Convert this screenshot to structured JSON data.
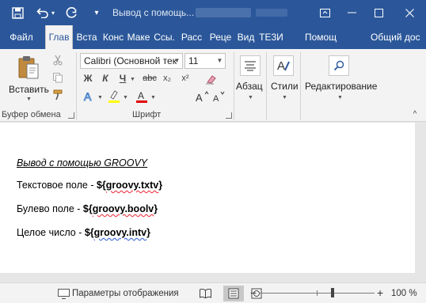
{
  "window": {
    "title": "Вывод с помощь..."
  },
  "tabs": [
    {
      "label": "Файл"
    },
    {
      "label": "Глав"
    },
    {
      "label": "Вста"
    },
    {
      "label": "Конс"
    },
    {
      "label": "Маке"
    },
    {
      "label": "Ссы."
    },
    {
      "label": "Расс"
    },
    {
      "label": "Реце"
    },
    {
      "label": "Вид"
    },
    {
      "label": "TE3И"
    },
    {
      "label": "Помощ"
    },
    {
      "label": "Общий дос"
    }
  ],
  "ribbon": {
    "clipboard": {
      "paste_label": "Вставить",
      "group_label": "Буфер обмена"
    },
    "font": {
      "font_name": "Calibri (Основной тек",
      "font_size": "11",
      "bold": "Ж",
      "italic": "К",
      "underline": "Ч",
      "strike": "abc",
      "subscript": "x₂",
      "superscript": "x²",
      "group_label": "Шрифт"
    },
    "paragraph_label": "Абзац",
    "styles_label": "Стили",
    "editing_label": "Редактирование"
  },
  "document": {
    "title": "Вывод с помощью GROOVY",
    "lines": [
      {
        "label": "Текстовое поле - ",
        "field": "${groovy.txtv}"
      },
      {
        "label": "Булево поле - ",
        "field": "${groovy.boolv}"
      },
      {
        "label": "Целое число - ",
        "field": "${groovy.intv}"
      }
    ]
  },
  "statusbar": {
    "display_settings": "Параметры отображения",
    "zoom": "100 %"
  },
  "colors": {
    "accent": "#2b579a",
    "highlight": "#ffff00",
    "font_color": "#e00000"
  }
}
